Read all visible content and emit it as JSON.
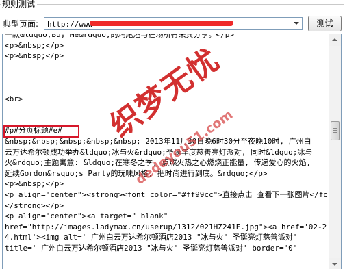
{
  "fieldset": {
    "legend": "规则测试"
  },
  "url_row": {
    "label": "典型页面:",
    "url_value": "http://www",
    "test_button": "测试"
  },
  "code_lines": [
    "一款&ldquo;Buy Me&rdquo;的鸡尾酒与在场所有来宾分享。</p>",
    "<p>&nbsp;</p>",
    "<p>&nbsp;</p>",
    "",
    "",
    "",
    "<br>",
    "",
    "",
    "#p#分页标题#e#",
    "&nbsp;&nbsp;&nbsp;&nbsp;&nbsp; 2013年11月30日晚6时30分至夜晚10时, 广州白",
    "云万达希尔顿成功举办&ldquo;冰与火&rdquo;圣诞年度慈善亮灯派对, 同时&ldquo;冰与",
    "火&rdquo;主题寓意: &ldquo;在寒冬之季, 点燃火热之心燃烧正能量, 传递爱心的火焰,",
    "延续Gordon&rsquo;s Party的玩味风格, 把时尚进行到底。&rdquo;</p>",
    "<p>&nbsp;</p>",
    "<p align=\"center\"><strong><font color=\"#ff99cc\">直接点击 查看下一张图片</font>",
    "</strong></p>",
    "<p align=\"center\"><a target=\"_blank\"",
    "href=\"http://images.ladymax.cn/userup/1312/021HZ241E.jpg\"><a href='02-20398_",
    "4.html'><img alt=' 广州白云万达希尔顿酒店2013 \"冰与火\" 圣诞亮灯慈善派对'",
    "title=' 广州白云万达希尔顿酒店2013 \"冰与火\" 圣诞亮灯慈善派对' border=\"0\""
  ],
  "watermark": {
    "title": "织梦无忧",
    "url": "dedeyou51.com"
  },
  "colors": {
    "redact": "#ef2a2a",
    "highlight_box": "#d6172a",
    "watermark": "#ce1a1a",
    "input_border": "#7f9db9"
  },
  "icons": {
    "select_arrow": "chevron-down-icon",
    "scroll_up": "scroll-up-arrow-icon",
    "scroll_down": "scroll-down-arrow-icon"
  }
}
